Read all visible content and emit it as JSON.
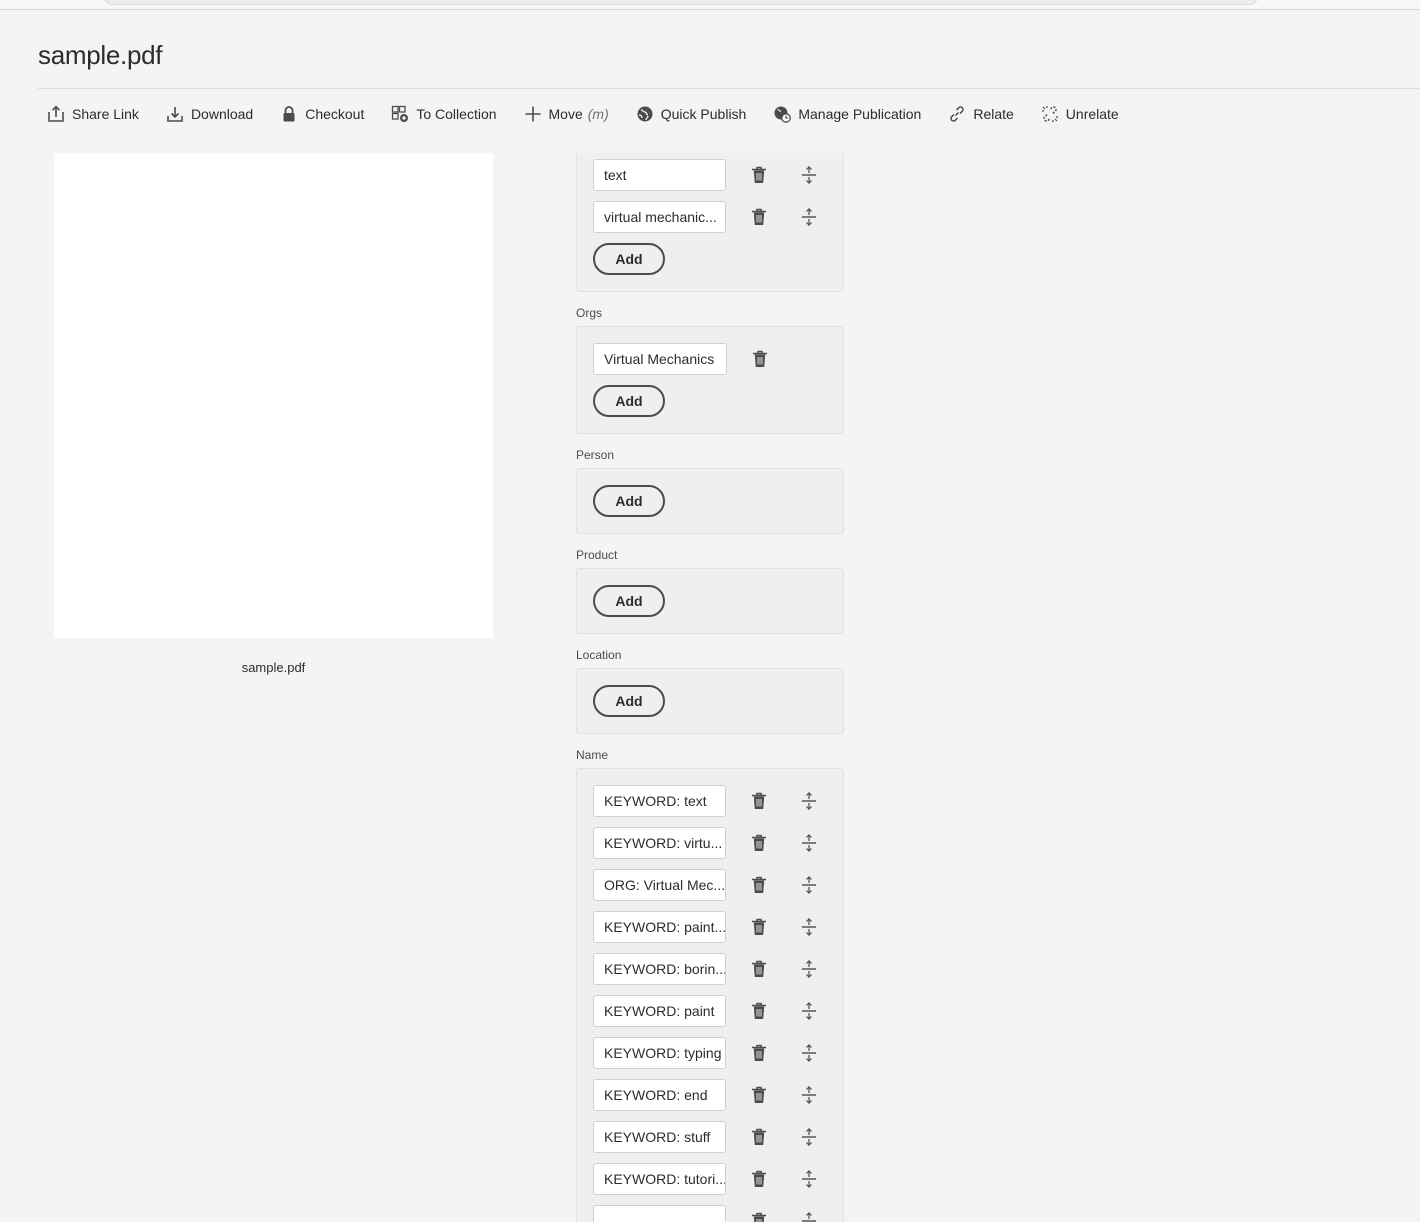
{
  "page": {
    "title": "sample.pdf"
  },
  "toolbar": {
    "items": [
      {
        "label": "Share Link",
        "icon": "share-icon"
      },
      {
        "label": "Download",
        "icon": "download-icon"
      },
      {
        "label": "Checkout",
        "icon": "lock-icon"
      },
      {
        "label": "To Collection",
        "icon": "collection-add-icon"
      },
      {
        "label": "Move",
        "sub": "(m)",
        "icon": "move-icon"
      },
      {
        "label": "Quick Publish",
        "icon": "globe-icon"
      },
      {
        "label": "Manage Publication",
        "icon": "globe-clock-icon"
      },
      {
        "label": "Relate",
        "icon": "link-icon"
      },
      {
        "label": "Unrelate",
        "icon": "unlink-icon"
      }
    ]
  },
  "preview": {
    "caption": "sample.pdf"
  },
  "form": {
    "keywords": {
      "values": [
        "text",
        "virtual mechanic..."
      ],
      "add_label": "Add"
    },
    "orgs": {
      "label": "Orgs",
      "values": [
        "Virtual Mechanics"
      ],
      "add_label": "Add"
    },
    "person": {
      "label": "Person",
      "add_label": "Add"
    },
    "product": {
      "label": "Product",
      "add_label": "Add"
    },
    "location": {
      "label": "Location",
      "add_label": "Add"
    },
    "name": {
      "label": "Name",
      "values": [
        "KEYWORD: text",
        "KEYWORD: virtu...",
        "ORG: Virtual Mec...",
        "KEYWORD: paint...",
        "KEYWORD: borin...",
        "KEYWORD: paint",
        "KEYWORD: typing",
        "KEYWORD: end",
        "KEYWORD: stuff",
        "KEYWORD: tutori...",
        ""
      ]
    }
  }
}
